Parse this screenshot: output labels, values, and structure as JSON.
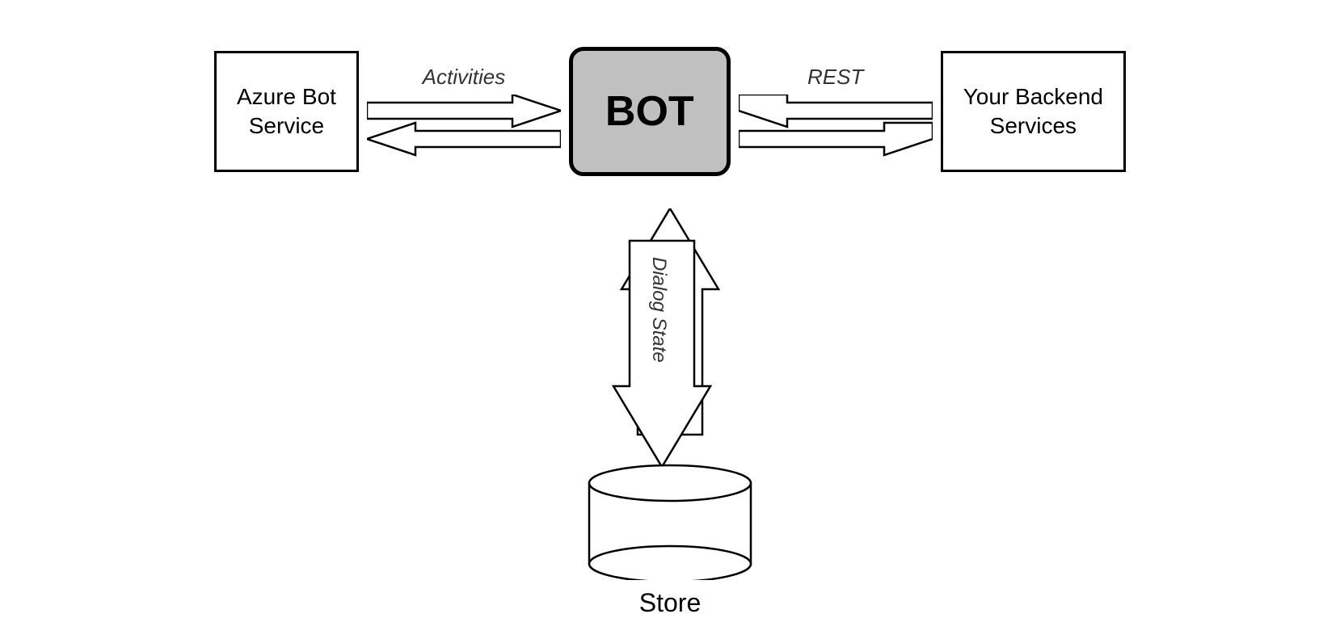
{
  "diagram": {
    "azure_box_label": "Azure Bot\nService",
    "bot_label": "BOT",
    "backend_box_label": "Your Backend\nServices",
    "activities_label": "Activities",
    "rest_label": "REST",
    "dialog_state_label": "Dialog State",
    "store_label": "Store"
  }
}
